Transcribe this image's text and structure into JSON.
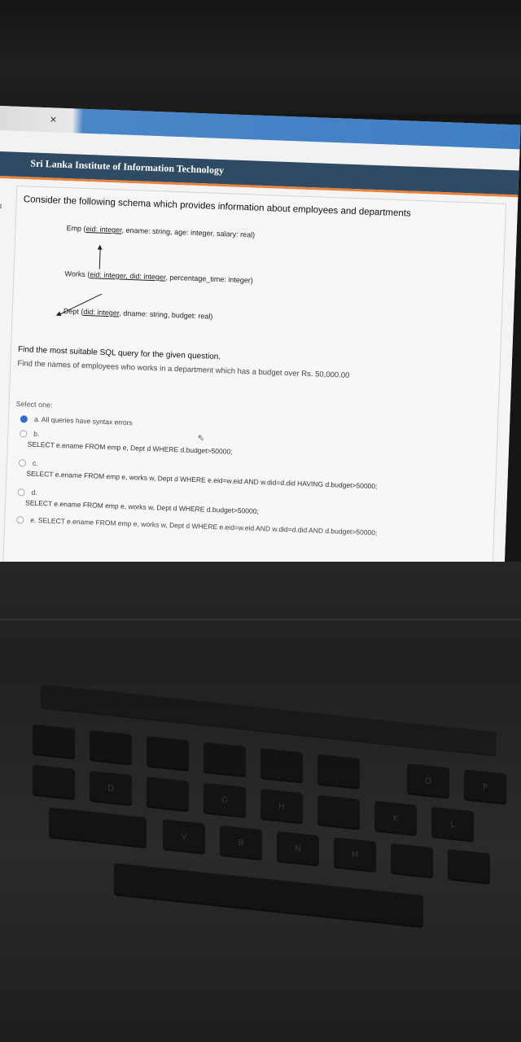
{
  "browser": {
    "close_glyph": "×",
    "site_title": "Sri Lanka Institute of Information Technology"
  },
  "question": {
    "title": "Consider the following schema which provides information about employees and departments",
    "schema": {
      "emp": {
        "name": "Emp (",
        "key": "eid: integer",
        "rest": ", ename: string, age: integer, salary: real)"
      },
      "works": {
        "name": "Works (",
        "key": "eid: integer, did: integer",
        "rest": ", percentage_time: integer)"
      },
      "dept": {
        "name": "Dept (",
        "key": "did: integer",
        "rest": ", dname: string, budget: real)"
      }
    },
    "prompt": "Find the most suitable SQL query for the given question.",
    "task": "Find the names of employees who works in a department which has a budget over Rs. 50,000.00",
    "select_label": "Select one:",
    "options": [
      {
        "label": "a. All queries have syntax errors",
        "query": "",
        "selected": true
      },
      {
        "label": "b.",
        "query": "SELECT e.ename FROM emp e, Dept d WHERE d.budget>50000;",
        "selected": false
      },
      {
        "label": "c.",
        "query": "SELECT e.ename FROM emp e, works w, Dept d WHERE e.eid=w.eid AND w.did=d.did HAVING d.budget>50000;",
        "selected": false
      },
      {
        "label": "d.",
        "query": "SELECT e.ename FROM emp e, works w, Dept d WHERE d.budget>50000;",
        "selected": false
      },
      {
        "label": "e. SELECT e.ename FROM emp e, works w, Dept d WHERE e.eid=w.eid AND w.did=d.did AND d.budget>50000;",
        "query": "",
        "selected": false
      }
    ]
  },
  "side_marks": [
    "d",
    ")"
  ],
  "keyboard": {
    "visible_keys": [
      "D",
      "G",
      "H",
      "V",
      "B",
      "N",
      "M",
      "K",
      "L",
      "O",
      "P"
    ]
  }
}
